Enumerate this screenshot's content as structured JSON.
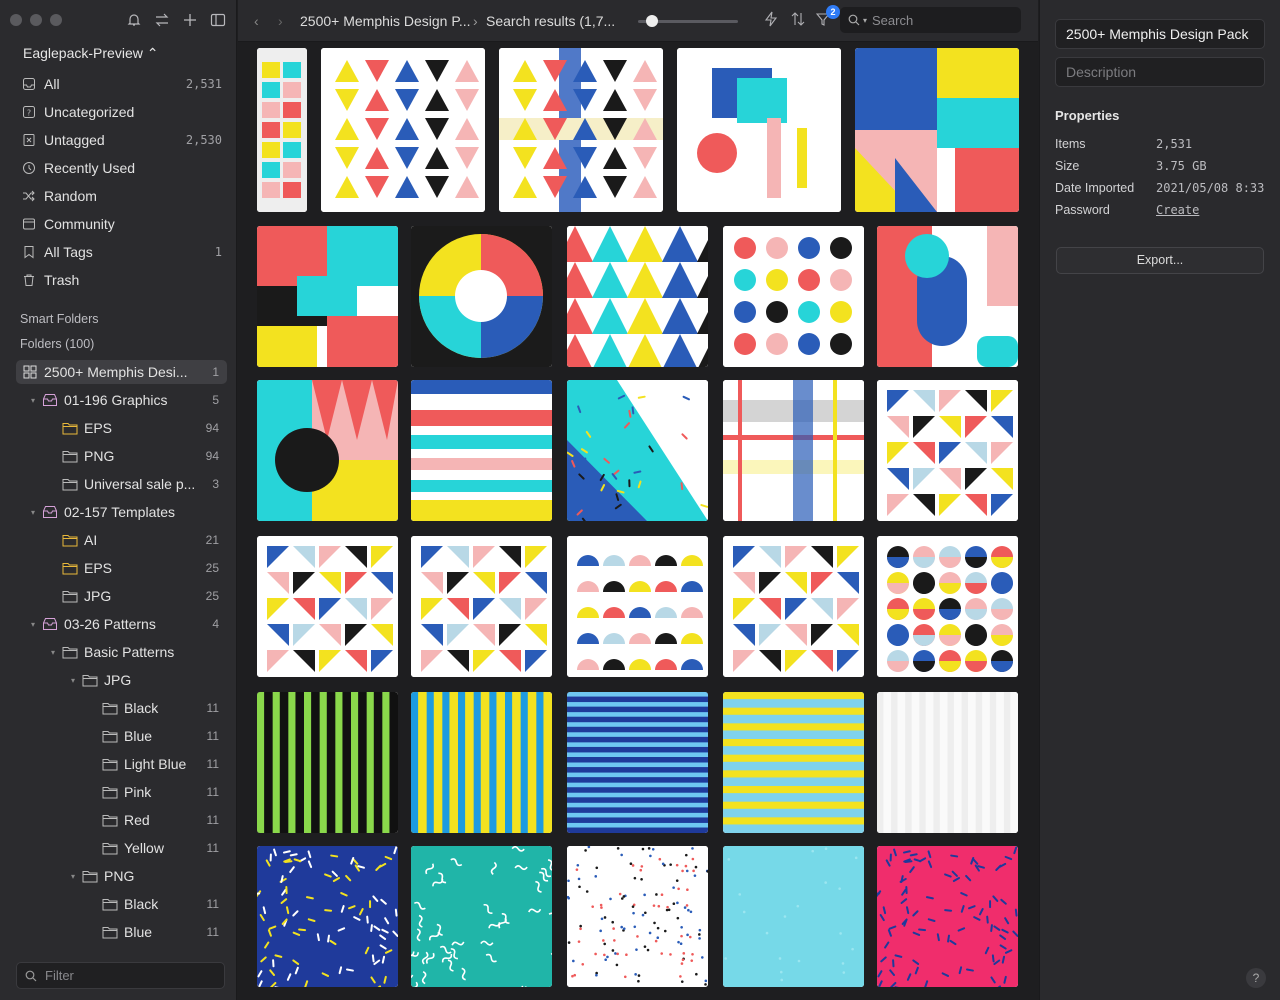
{
  "sidebar": {
    "library": "Eaglepack-Preview ⌃",
    "nav": [
      {
        "label": "All",
        "count": "2,531",
        "icon": "inbox-icon"
      },
      {
        "label": "Uncategorized",
        "count": "",
        "icon": "question-icon"
      },
      {
        "label": "Untagged",
        "count": "2,530",
        "icon": "untagged-icon"
      },
      {
        "label": "Recently Used",
        "count": "",
        "icon": "clock-icon"
      },
      {
        "label": "Random",
        "count": "",
        "icon": "shuffle-icon"
      },
      {
        "label": "Community",
        "count": "",
        "icon": "community-icon"
      },
      {
        "label": "All Tags",
        "count": "1",
        "icon": "bookmark-icon"
      },
      {
        "label": "Trash",
        "count": "",
        "icon": "trash-icon"
      }
    ],
    "smart_folders": "Smart Folders",
    "folders_heading": "Folders (100)",
    "folders": [
      {
        "label": "2500+ Memphis Desi...",
        "count": "1",
        "depth": 0,
        "caret": "▾",
        "kind": "grid"
      },
      {
        "label": "01-196 Graphics",
        "count": "5",
        "depth": 1,
        "caret": "▾",
        "kind": "tray"
      },
      {
        "label": "EPS",
        "count": "94",
        "depth": 2,
        "caret": "",
        "kind": "yellow"
      },
      {
        "label": "PNG",
        "count": "94",
        "depth": 2,
        "caret": "",
        "kind": "folder"
      },
      {
        "label": "Universal sale p...",
        "count": "3",
        "depth": 2,
        "caret": "",
        "kind": "folder"
      },
      {
        "label": "02-157 Templates",
        "count": "",
        "depth": 1,
        "caret": "▾",
        "kind": "tray"
      },
      {
        "label": "AI",
        "count": "21",
        "depth": 2,
        "caret": "",
        "kind": "yellow"
      },
      {
        "label": "EPS",
        "count": "25",
        "depth": 2,
        "caret": "",
        "kind": "yellow"
      },
      {
        "label": "JPG",
        "count": "25",
        "depth": 2,
        "caret": "",
        "kind": "folder"
      },
      {
        "label": "03-26 Patterns",
        "count": "4",
        "depth": 1,
        "caret": "▾",
        "kind": "tray"
      },
      {
        "label": "Basic Patterns",
        "count": "",
        "depth": 2,
        "caret": "▾",
        "kind": "folder"
      },
      {
        "label": "JPG",
        "count": "",
        "depth": 3,
        "caret": "▾",
        "kind": "folder"
      },
      {
        "label": "Black",
        "count": "11",
        "depth": 4,
        "caret": "",
        "kind": "folder"
      },
      {
        "label": "Blue",
        "count": "11",
        "depth": 4,
        "caret": "",
        "kind": "folder"
      },
      {
        "label": "Light Blue",
        "count": "11",
        "depth": 4,
        "caret": "",
        "kind": "folder"
      },
      {
        "label": "Pink",
        "count": "11",
        "depth": 4,
        "caret": "",
        "kind": "folder"
      },
      {
        "label": "Red",
        "count": "11",
        "depth": 4,
        "caret": "",
        "kind": "folder"
      },
      {
        "label": "Yellow",
        "count": "11",
        "depth": 4,
        "caret": "",
        "kind": "folder"
      },
      {
        "label": "PNG",
        "count": "",
        "depth": 3,
        "caret": "▾",
        "kind": "folder"
      },
      {
        "label": "Black",
        "count": "11",
        "depth": 4,
        "caret": "",
        "kind": "folder"
      },
      {
        "label": "Blue",
        "count": "11",
        "depth": 4,
        "caret": "",
        "kind": "folder"
      }
    ],
    "filter_placeholder": "Filter"
  },
  "toolbar": {
    "breadcrumb_folder": "2500+ Memphis Design P...",
    "breadcrumb_sep": "›",
    "breadcrumb_results": "Search results (1,7...",
    "filter_badge": "2",
    "search_placeholder": "Search",
    "zoom_level": 0.12
  },
  "thumbnails": {
    "rows": [
      [
        "poster-sheet",
        "triangles-a",
        "triangles-b",
        "blobs-teal",
        "collage-grid"
      ],
      [
        "collage-patch",
        "circle-segments",
        "triangle-mosaic",
        "dots-grid",
        "organic-shapes"
      ],
      [
        "zigzag-teal",
        "stripes-red",
        "confetti-diagonal",
        "plaid",
        "tile-triangles"
      ],
      [
        "tile-a",
        "tile-b",
        "tile-semicircles",
        "tile-c",
        "tile-circles"
      ],
      [
        "stripes-green",
        "stripes-yellow",
        "stripes-blue",
        "stripes-ltblue",
        "stripes-grey"
      ],
      [
        "confetti-navy",
        "squiggle-teal",
        "dots-white",
        "solid-skyblue",
        "dashes-pink"
      ]
    ]
  },
  "inspector": {
    "title": "2500+ Memphis Design Pack",
    "description_placeholder": "Description",
    "properties_label": "Properties",
    "properties": [
      {
        "key": "Items",
        "value": "2,531"
      },
      {
        "key": "Size",
        "value": "3.75 GB"
      },
      {
        "key": "Date Imported",
        "value": "2021/05/08 8:33"
      },
      {
        "key": "Password",
        "value": "Create"
      }
    ],
    "export_label": "Export...",
    "help_label": "?"
  },
  "colors": {
    "accent": "#2f7bf5",
    "sidebar_bg": "#2b2b2e",
    "panel_bg": "#2a2a2d",
    "grid_bg": "#1e1e20"
  }
}
